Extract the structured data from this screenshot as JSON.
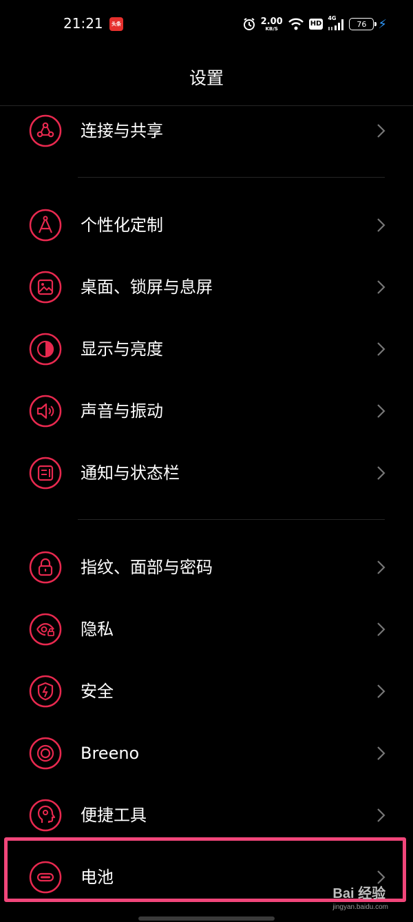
{
  "status_bar": {
    "time": "21:21",
    "app_badge": "头条",
    "net_speed": "2.00",
    "net_unit": "KB/S",
    "hd": "HD",
    "network": "4G",
    "battery": "76"
  },
  "header": {
    "title": "设置"
  },
  "menu": [
    {
      "label": "连接与共享",
      "icon": "share-network-icon"
    },
    {
      "label": "个性化定制",
      "icon": "compass-icon"
    },
    {
      "label": "桌面、锁屏与息屏",
      "icon": "wallpaper-icon"
    },
    {
      "label": "显示与亮度",
      "icon": "contrast-icon"
    },
    {
      "label": "声音与振动",
      "icon": "speaker-icon"
    },
    {
      "label": "通知与状态栏",
      "icon": "notification-panel-icon"
    },
    {
      "label": "指纹、面部与密码",
      "icon": "lock-icon"
    },
    {
      "label": "隐私",
      "icon": "privacy-eye-icon"
    },
    {
      "label": "安全",
      "icon": "shield-icon"
    },
    {
      "label": "Breeno",
      "icon": "breeno-icon"
    },
    {
      "label": "便捷工具",
      "icon": "assistant-head-icon"
    },
    {
      "label": "电池",
      "icon": "battery-icon"
    }
  ],
  "watermark": {
    "brand": "Bai 经验",
    "url": "jingyan.baidu.com"
  },
  "colors": {
    "accent": "#e8294f",
    "highlight": "#f1467a",
    "background": "#000000"
  }
}
